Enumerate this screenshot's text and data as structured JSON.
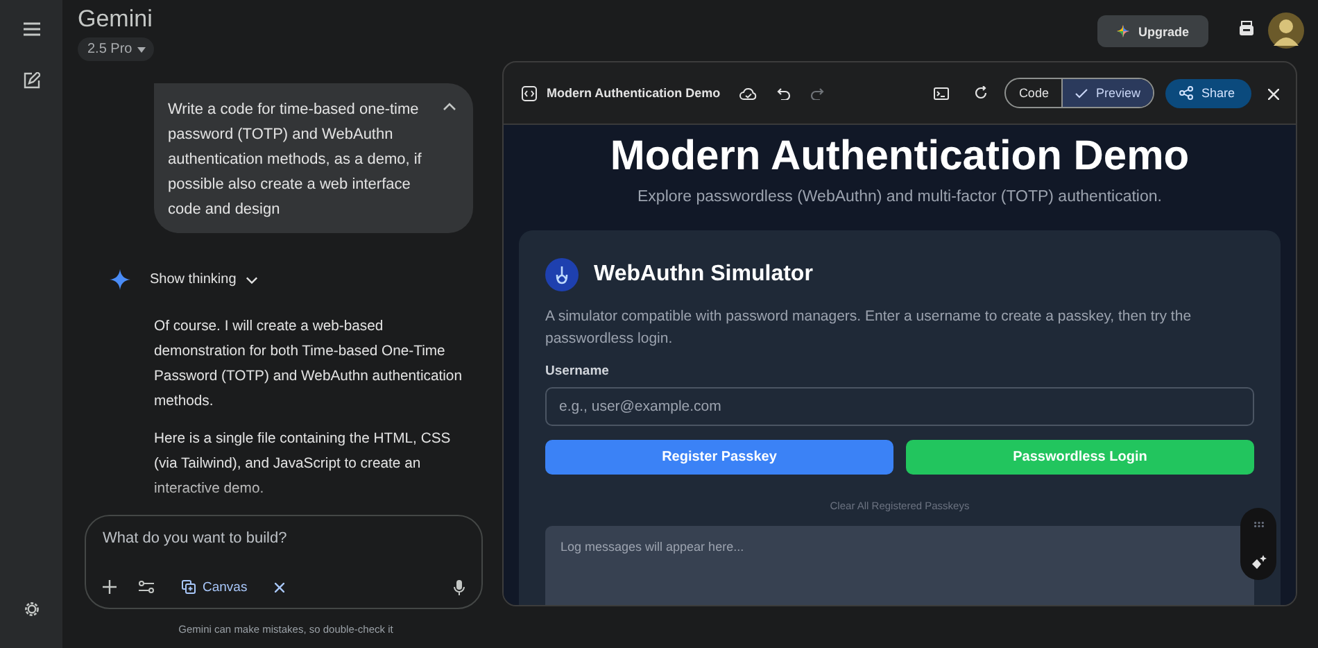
{
  "app": {
    "title": "Gemini",
    "model": "2.5 Pro",
    "upgrade": "Upgrade"
  },
  "chat": {
    "prompt": {
      "text": "Write a code for time-based one-time password (TOTP) and WebAuthn authentication methods, as a demo, if possible also create a web interface code and design",
      "expanded": true
    },
    "thinking": {
      "label": "Show thinking",
      "expanded": false
    },
    "response": [
      "Of course. I will create a web-based demonstration for both Time-based One-Time Password (TOTP) and WebAuthn authentication methods.",
      "Here is a single file containing the HTML, CSS (via Tailwind), and JavaScript to create an interactive demo."
    ],
    "input": {
      "placeholder": "What do you want to build?",
      "tool": "Canvas"
    },
    "disclaimer": "Gemini can make mistakes, so double-check it"
  },
  "canvas": {
    "title": "Modern Authentication Demo",
    "views": [
      {
        "label": "Code",
        "selected": false
      },
      {
        "label": "Preview",
        "selected": true
      }
    ],
    "share": "Share",
    "preview": {
      "heading": "Modern Authentication Demo",
      "subtitle": "Explore passwordless (WebAuthn) and multi-factor (TOTP) authentication.",
      "card": {
        "title": "WebAuthn Simulator",
        "description": "A simulator compatible with password managers. Enter a username to create a passkey, then try the passwordless login.",
        "field_label": "Username",
        "placeholder": "e.g., user@example.com",
        "buttons": [
          {
            "label": "Register Passkey",
            "color": "#3b82f6"
          },
          {
            "label": "Passwordless Login",
            "color": "#22c55e"
          }
        ],
        "clear_link": "Clear All Registered Passkeys",
        "log_placeholder": "Log messages will appear here..."
      }
    }
  }
}
